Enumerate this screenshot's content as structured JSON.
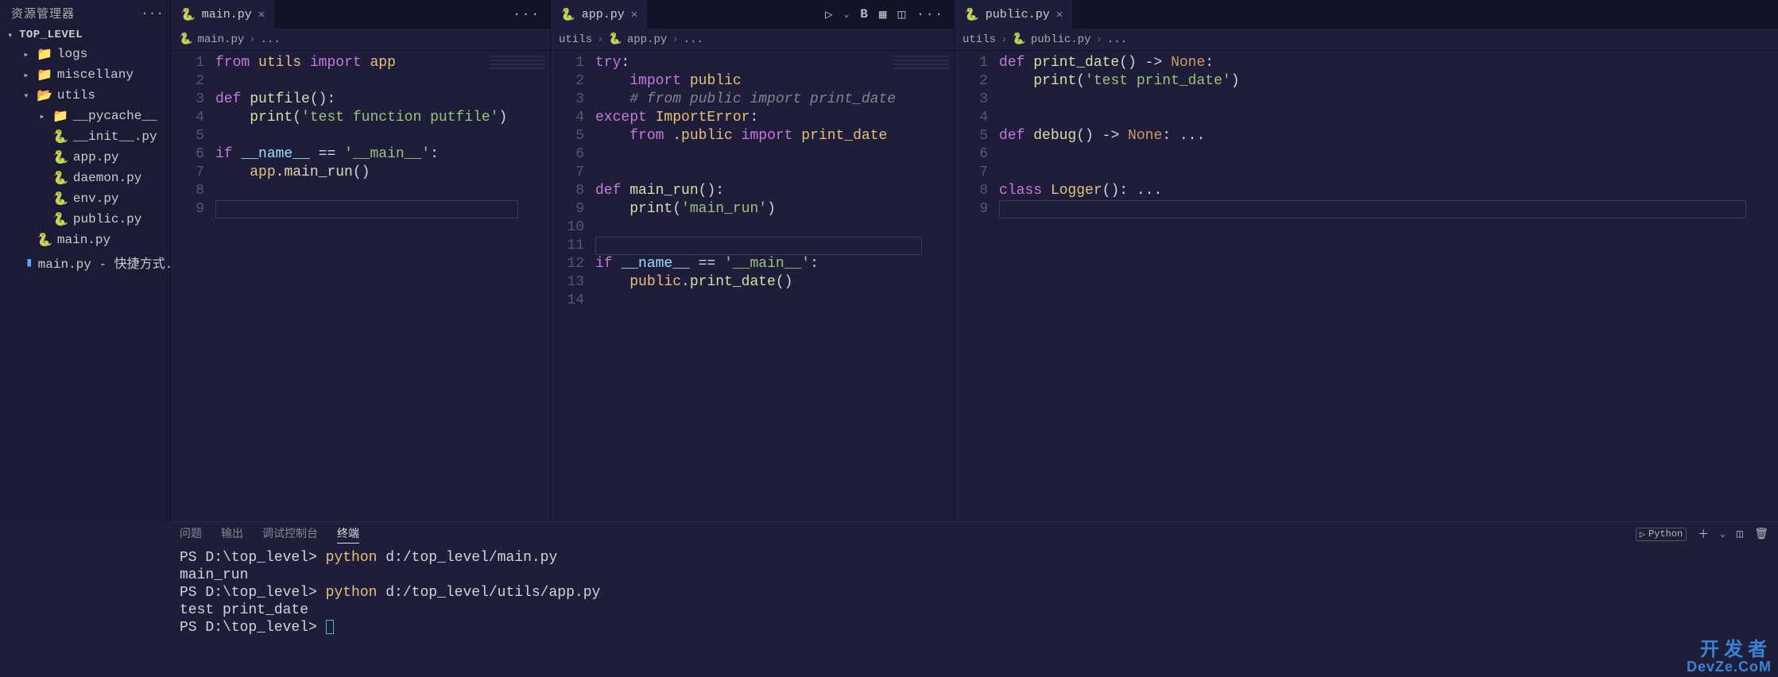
{
  "sidebar": {
    "title": "资源管理器",
    "project": "TOP_LEVEL",
    "tree": [
      {
        "type": "folder",
        "label": "logs",
        "level": 1,
        "expanded": false
      },
      {
        "type": "folder",
        "label": "miscellany",
        "level": 1,
        "expanded": false
      },
      {
        "type": "folder",
        "label": "utils",
        "level": 1,
        "expanded": true
      },
      {
        "type": "folder",
        "label": "__pycache__",
        "level": 2,
        "expanded": false
      },
      {
        "type": "pyfile",
        "label": "__init__.py",
        "level": 2
      },
      {
        "type": "pyfile",
        "label": "app.py",
        "level": 2
      },
      {
        "type": "pyfile",
        "label": "daemon.py",
        "level": 2
      },
      {
        "type": "pyfile",
        "label": "env.py",
        "level": 2
      },
      {
        "type": "pyfile",
        "label": "public.py",
        "level": 2
      },
      {
        "type": "pyfile",
        "label": "main.py",
        "level": 1
      },
      {
        "type": "file",
        "label": "main.py - 快捷方式.lnk",
        "level": 1
      }
    ]
  },
  "editors": {
    "group1": {
      "tab": {
        "label": "main.py",
        "icon": "python"
      },
      "breadcrumb": [
        "main.py",
        "..."
      ],
      "lines": [
        [
          {
            "t": "kw",
            "v": "from"
          },
          {
            "t": "op",
            "v": " "
          },
          {
            "t": "mod",
            "v": "utils"
          },
          {
            "t": "op",
            "v": " "
          },
          {
            "t": "kw",
            "v": "import"
          },
          {
            "t": "op",
            "v": " "
          },
          {
            "t": "mod",
            "v": "app"
          }
        ],
        [],
        [
          {
            "t": "kw",
            "v": "def"
          },
          {
            "t": "op",
            "v": " "
          },
          {
            "t": "fn",
            "v": "putfile"
          },
          {
            "t": "punc",
            "v": "():"
          }
        ],
        [
          {
            "t": "op",
            "v": "    "
          },
          {
            "t": "fn",
            "v": "print"
          },
          {
            "t": "punc",
            "v": "("
          },
          {
            "t": "str",
            "v": "'test function putfile'"
          },
          {
            "t": "punc",
            "v": ")"
          }
        ],
        [],
        [
          {
            "t": "kw",
            "v": "if"
          },
          {
            "t": "op",
            "v": " "
          },
          {
            "t": "builtinv",
            "v": "__name__"
          },
          {
            "t": "op",
            "v": " == "
          },
          {
            "t": "str",
            "v": "'__main__'"
          },
          {
            "t": "punc",
            "v": ":"
          }
        ],
        [
          {
            "t": "op",
            "v": "    "
          },
          {
            "t": "mod",
            "v": "app"
          },
          {
            "t": "punc",
            "v": "."
          },
          {
            "t": "fn",
            "v": "main_run"
          },
          {
            "t": "punc",
            "v": "()"
          }
        ],
        [],
        []
      ],
      "cursor_line": 9
    },
    "group2": {
      "tab": {
        "label": "app.py",
        "icon": "python"
      },
      "breadcrumb": [
        "utils",
        "app.py",
        "..."
      ],
      "actions": [
        "run",
        "run-chevron",
        "bold-b",
        "save-all",
        "split",
        "more"
      ],
      "lines": [
        [
          {
            "t": "kw",
            "v": "try"
          },
          {
            "t": "punc",
            "v": ":"
          }
        ],
        [
          {
            "t": "op",
            "v": "    "
          },
          {
            "t": "kw",
            "v": "import"
          },
          {
            "t": "op",
            "v": " "
          },
          {
            "t": "mod",
            "v": "public"
          }
        ],
        [
          {
            "t": "op",
            "v": "    "
          },
          {
            "t": "cmt",
            "v": "# from public import print_date"
          }
        ],
        [
          {
            "t": "kw",
            "v": "except"
          },
          {
            "t": "op",
            "v": " "
          },
          {
            "t": "cls",
            "v": "ImportError"
          },
          {
            "t": "punc",
            "v": ":"
          }
        ],
        [
          {
            "t": "op",
            "v": "    "
          },
          {
            "t": "kw",
            "v": "from"
          },
          {
            "t": "op",
            "v": " ."
          },
          {
            "t": "mod",
            "v": "public"
          },
          {
            "t": "op",
            "v": " "
          },
          {
            "t": "kw",
            "v": "import"
          },
          {
            "t": "op",
            "v": " "
          },
          {
            "t": "mod",
            "v": "print_date"
          }
        ],
        [],
        [],
        [
          {
            "t": "kw",
            "v": "def"
          },
          {
            "t": "op",
            "v": " "
          },
          {
            "t": "fn",
            "v": "main_run"
          },
          {
            "t": "punc",
            "v": "():"
          }
        ],
        [
          {
            "t": "op",
            "v": "    "
          },
          {
            "t": "fn",
            "v": "print"
          },
          {
            "t": "punc",
            "v": "("
          },
          {
            "t": "str",
            "v": "'main_run'"
          },
          {
            "t": "punc",
            "v": ")"
          }
        ],
        [],
        [],
        [
          {
            "t": "kw",
            "v": "if"
          },
          {
            "t": "op",
            "v": " "
          },
          {
            "t": "builtinv",
            "v": "__name__"
          },
          {
            "t": "op",
            "v": " == "
          },
          {
            "t": "str",
            "v": "'__main__'"
          },
          {
            "t": "punc",
            "v": ":"
          }
        ],
        [
          {
            "t": "op",
            "v": "    "
          },
          {
            "t": "mod",
            "v": "public"
          },
          {
            "t": "punc",
            "v": "."
          },
          {
            "t": "fn",
            "v": "print_date"
          },
          {
            "t": "punc",
            "v": "()"
          }
        ],
        []
      ],
      "cursor_line": 11
    },
    "group3": {
      "tab": {
        "label": "public.py",
        "icon": "python"
      },
      "breadcrumb": [
        "utils",
        "public.py",
        "..."
      ],
      "lines": [
        [
          {
            "t": "kw",
            "v": "def"
          },
          {
            "t": "op",
            "v": " "
          },
          {
            "t": "fn",
            "v": "print_date"
          },
          {
            "t": "punc",
            "v": "() -> "
          },
          {
            "t": "kw2",
            "v": "None"
          },
          {
            "t": "punc",
            "v": ":"
          }
        ],
        [
          {
            "t": "op",
            "v": "    "
          },
          {
            "t": "fn",
            "v": "print"
          },
          {
            "t": "punc",
            "v": "("
          },
          {
            "t": "str",
            "v": "'test print_date'"
          },
          {
            "t": "punc",
            "v": ")"
          }
        ],
        [],
        [],
        [
          {
            "t": "kw",
            "v": "def"
          },
          {
            "t": "op",
            "v": " "
          },
          {
            "t": "fn",
            "v": "debug"
          },
          {
            "t": "punc",
            "v": "() -> "
          },
          {
            "t": "kw2",
            "v": "None"
          },
          {
            "t": "punc",
            "v": ": ..."
          }
        ],
        [],
        [],
        [
          {
            "t": "kw",
            "v": "class"
          },
          {
            "t": "op",
            "v": " "
          },
          {
            "t": "cls",
            "v": "Logger"
          },
          {
            "t": "punc",
            "v": "(): ..."
          }
        ],
        []
      ],
      "cursor_line": 9
    }
  },
  "panel": {
    "tabs": [
      "问题",
      "输出",
      "调试控制台",
      "终端"
    ],
    "active_tab": 3,
    "shell_label": "Python",
    "terminal_lines": [
      {
        "segments": [
          {
            "t": "prompt",
            "v": "PS D:\\top_level> "
          },
          {
            "t": "cmd",
            "v": "python"
          },
          {
            "t": "prompt",
            "v": " d:/top_level/main.py"
          }
        ]
      },
      {
        "segments": [
          {
            "t": "prompt",
            "v": "main_run"
          }
        ]
      },
      {
        "segments": [
          {
            "t": "prompt",
            "v": "PS D:\\top_level> "
          },
          {
            "t": "cmd",
            "v": "python"
          },
          {
            "t": "prompt",
            "v": " d:/top_level/utils/app.py"
          }
        ]
      },
      {
        "segments": [
          {
            "t": "prompt",
            "v": "test print_date"
          }
        ]
      },
      {
        "segments": [
          {
            "t": "prompt",
            "v": "PS D:\\top_level> "
          }
        ],
        "cursor": true
      }
    ]
  },
  "watermark": {
    "line1": "开发者",
    "line2": "DevZe.CoM"
  }
}
